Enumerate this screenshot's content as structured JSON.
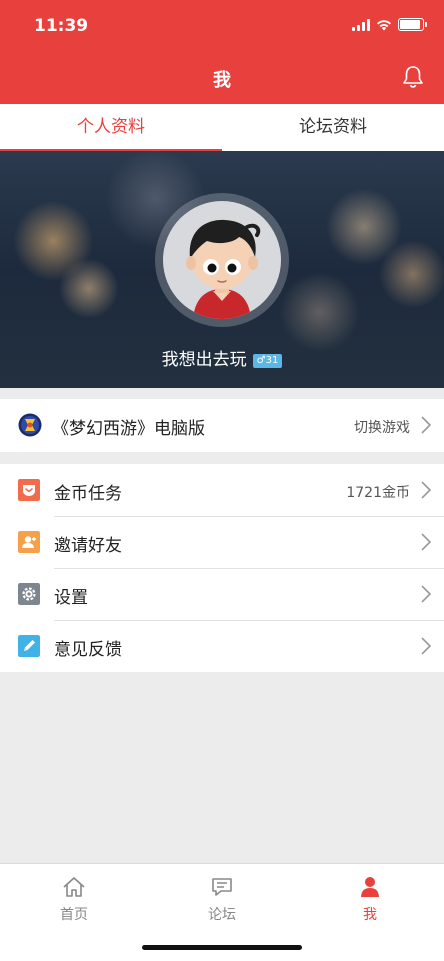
{
  "status_bar": {
    "time": "11:39"
  },
  "header": {
    "title": "我",
    "bell_icon": "bell-icon"
  },
  "tabs": [
    {
      "label": "个人资料",
      "active": true
    },
    {
      "label": "论坛资料",
      "active": false
    }
  ],
  "profile": {
    "username": "我想出去玩",
    "level_badge": "♂31"
  },
  "game": {
    "name": "《梦幻西游》电脑版",
    "switch_label": "切换游戏",
    "logo_icon": "game-logo-icon"
  },
  "menu": [
    {
      "label": "金币任务",
      "value": "1721金币",
      "icon": "gold-task-icon",
      "color": "#f26b4a"
    },
    {
      "label": "邀请好友",
      "value": "",
      "icon": "invite-friend-icon",
      "color": "#f6a14a"
    },
    {
      "label": "设置",
      "value": "",
      "icon": "settings-icon",
      "color": "#7d868f"
    },
    {
      "label": "意见反馈",
      "value": "",
      "icon": "feedback-icon",
      "color": "#3fb2e6"
    }
  ],
  "bottom_nav": [
    {
      "label": "首页",
      "icon": "home-icon",
      "active": false
    },
    {
      "label": "论坛",
      "icon": "forum-icon",
      "active": false
    },
    {
      "label": "我",
      "icon": "profile-icon",
      "active": true
    }
  ],
  "colors": {
    "accent": "#e8413d",
    "background": "#ececec"
  }
}
